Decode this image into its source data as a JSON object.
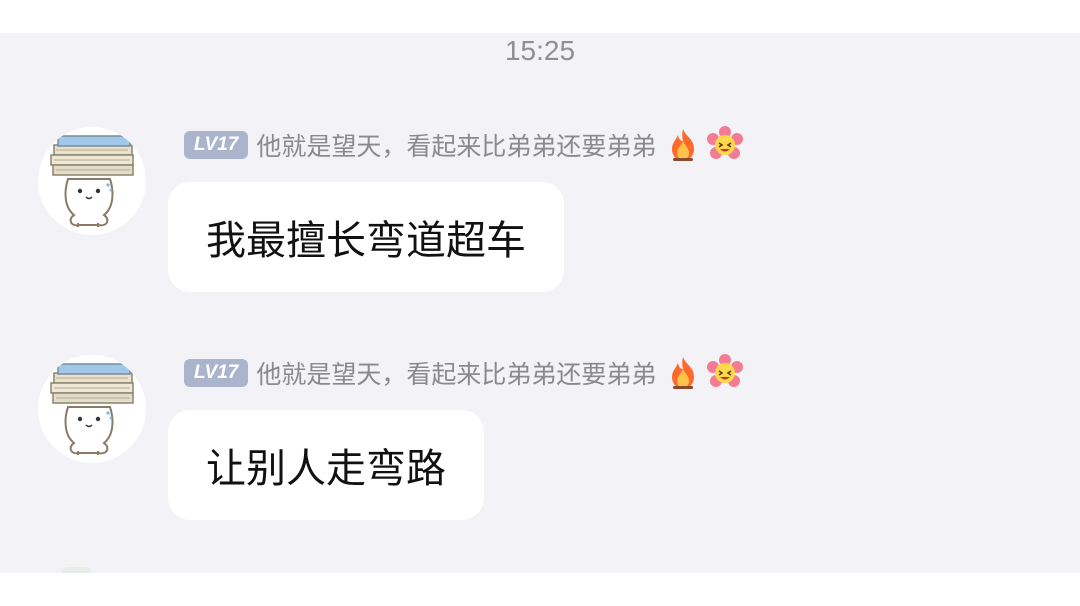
{
  "chat": {
    "timestamp": "15:25",
    "messages": [
      {
        "level": "LV17",
        "sender": "他就是望天，看起来比弟弟还要弟弟",
        "text": "我最擅长弯道超车",
        "icons": [
          "avatar-bookstack",
          "flame-icon",
          "flower-emoji-icon"
        ]
      },
      {
        "level": "LV17",
        "sender": "他就是望天，看起来比弟弟还要弟弟",
        "text": "让别人走弯路",
        "icons": [
          "avatar-bookstack",
          "flame-icon",
          "flower-emoji-icon"
        ]
      }
    ]
  },
  "colors": {
    "chat_background": "#f2f2f7",
    "bubble": "#ffffff",
    "level_badge": "#aab4cc",
    "sender_text": "#8a8a8e",
    "timestamp_text": "#8e8e93"
  }
}
